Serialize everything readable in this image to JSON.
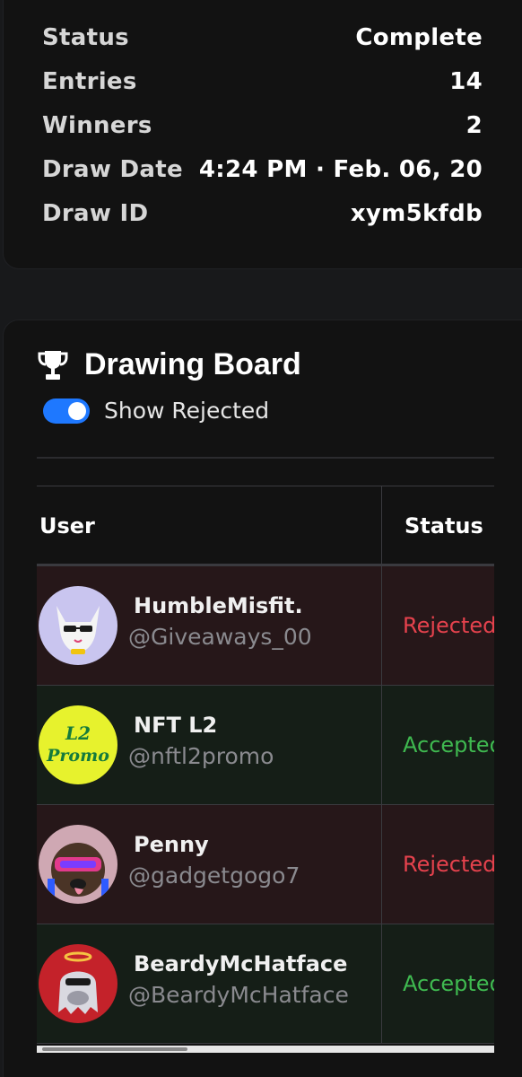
{
  "details": [
    {
      "label": "Status",
      "value": "Complete"
    },
    {
      "label": "Entries",
      "value": "14"
    },
    {
      "label": "Winners",
      "value": "2"
    },
    {
      "label": "Draw Date",
      "value": "4:24 PM · Feb. 06, 20"
    },
    {
      "label": "Draw ID",
      "value": "xym5kfdb"
    }
  ],
  "board": {
    "title": "Drawing Board",
    "icon": "trophy-icon",
    "toggle_label": "Show Rejected",
    "toggle_on": true
  },
  "table": {
    "columns": [
      "User",
      "Status"
    ],
    "rows": [
      {
        "name": "HumbleMisfit.",
        "handle": "@Giveaways_00",
        "status": "Rejected",
        "state": "rejected"
      },
      {
        "name": "NFT L2",
        "handle": "@nftl2promo",
        "status": "Accepted",
        "state": "accepted",
        "avatar_text": [
          "L2",
          "Promo"
        ]
      },
      {
        "name": "Penny",
        "handle": "@gadgetgogo7",
        "status": "Rejected",
        "state": "rejected"
      },
      {
        "name": "BeardyMcHatface",
        "handle": "@BeardyMcHatface",
        "status": "Accepted",
        "state": "accepted"
      }
    ]
  },
  "colors": {
    "accent": "#1e78ff",
    "rejected": "#e5424d",
    "accepted": "#3fb950"
  }
}
